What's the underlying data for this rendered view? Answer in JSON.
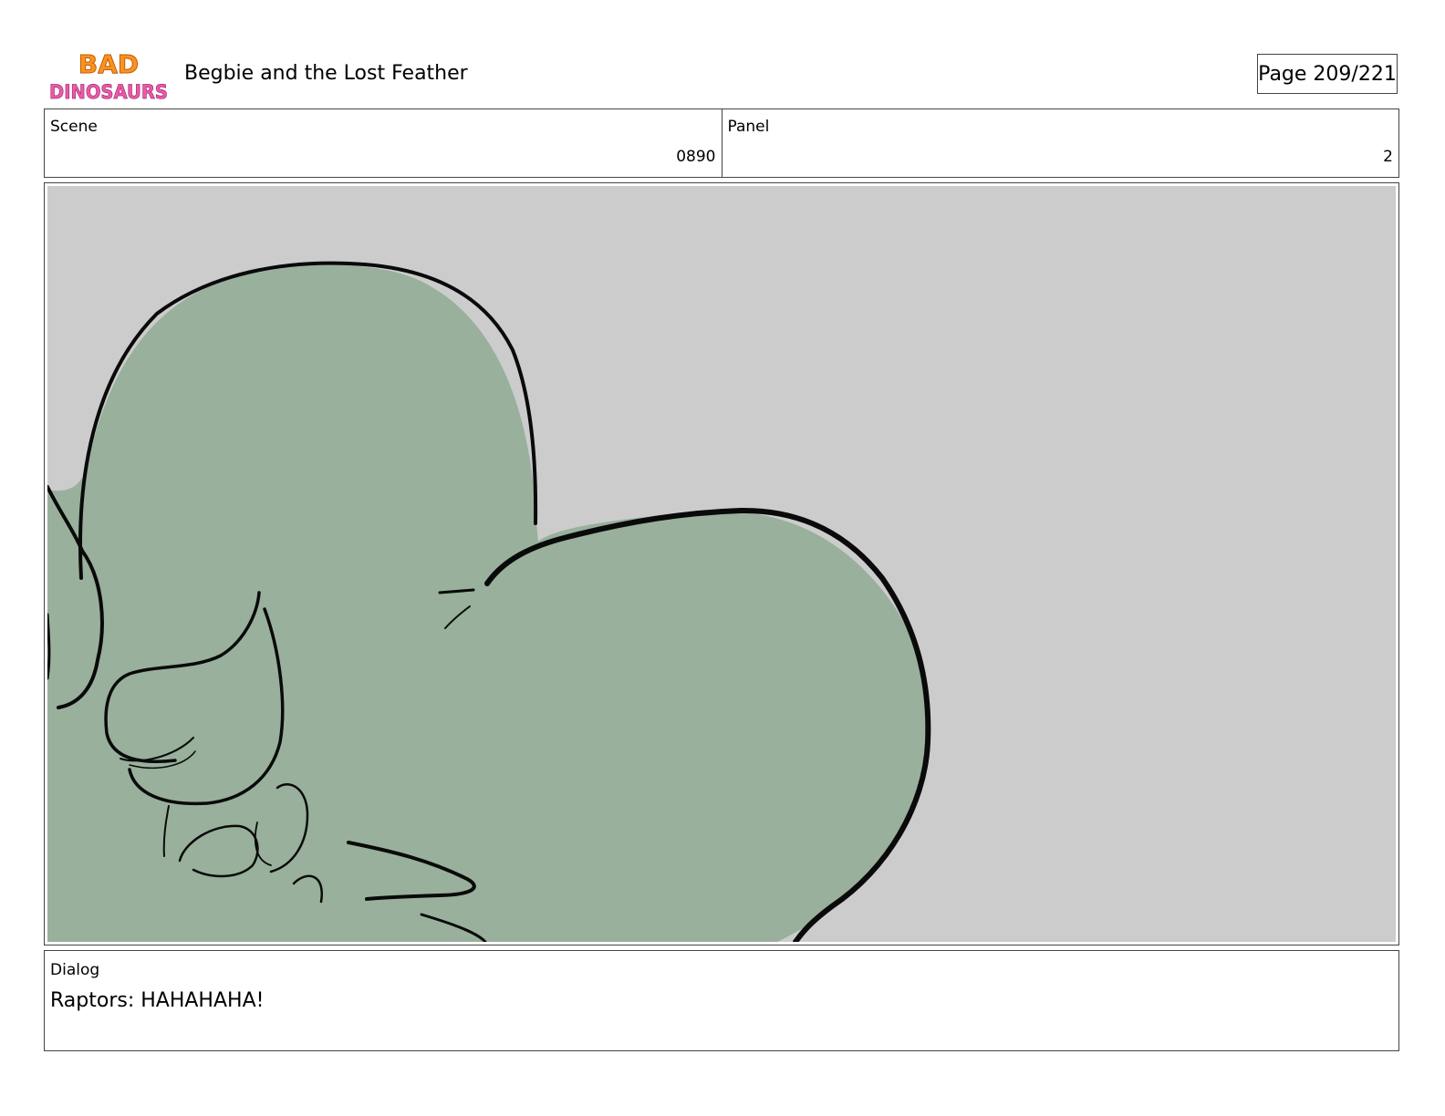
{
  "header": {
    "logo": {
      "line1": "BAD",
      "line2": "DINOSAURS"
    },
    "title": "Begbie and the Lost Feather",
    "page": "Page 209/221"
  },
  "info": {
    "scene_label": "Scene",
    "scene_value": "0890",
    "panel_label": "Panel",
    "panel_value": "2"
  },
  "panel": {
    "background_color": "#cccccc",
    "character_color": "#98b09c",
    "line_color": "#0a0a0a"
  },
  "dialog": {
    "label": "Dialog",
    "text": "Raptors: HAHAHAHA!"
  }
}
